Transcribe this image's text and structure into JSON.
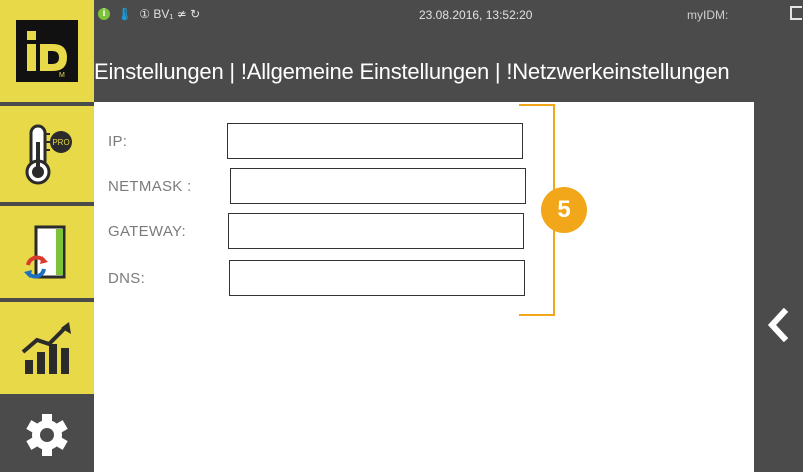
{
  "status_bar": {
    "info_icon": "i",
    "temperature_icon": "temperature-icon",
    "status_text": "① BV₁ ≄ ↻",
    "datetime": "23.08.2016, 13:52:20",
    "device_label": "myIDM:"
  },
  "header": {
    "title": "Einstellungen | !Allgemeine Einstellungen | !Netzwerkeinstellungen"
  },
  "sidebar": {
    "logo_text": "iD",
    "logo_sub": "M",
    "items": [
      {
        "name": "heat-pump-pro",
        "badge": "PRO"
      },
      {
        "name": "energy-manager"
      },
      {
        "name": "statistics"
      },
      {
        "name": "settings"
      }
    ]
  },
  "form": {
    "fields": [
      {
        "label": "IP:",
        "value": ""
      },
      {
        "label": "NETMASK :",
        "value": ""
      },
      {
        "label": "GATEWAY:",
        "value": ""
      },
      {
        "label": "DNS:",
        "value": ""
      }
    ]
  },
  "callout": {
    "number": "5",
    "color": "#f1a719"
  },
  "colors": {
    "accent": "#e7d947",
    "dark": "#4b4b4b",
    "callout": "#f1a719"
  }
}
